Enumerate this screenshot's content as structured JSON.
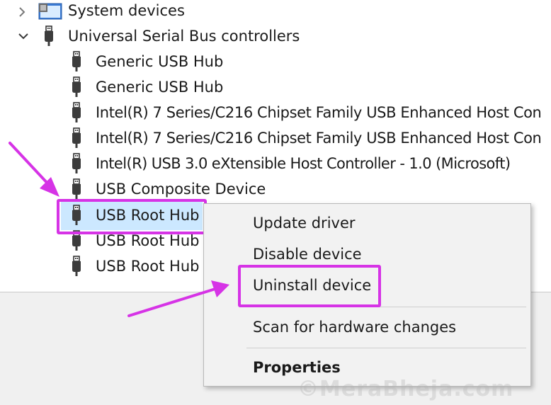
{
  "tree": {
    "system_devices": {
      "label": "System devices",
      "expanded": false,
      "icon": "system-devices-icon"
    },
    "usb_controllers": {
      "label": "Universal Serial Bus controllers",
      "expanded": true,
      "icon": "usb-plug-icon"
    },
    "children": [
      {
        "label": "Generic USB Hub",
        "icon": "usb-plug-icon",
        "selected": false
      },
      {
        "label": "Generic USB Hub",
        "icon": "usb-plug-icon",
        "selected": false
      },
      {
        "label": "Intel(R) 7 Series/C216 Chipset Family USB Enhanced Host Con",
        "icon": "usb-plug-icon",
        "selected": false
      },
      {
        "label": "Intel(R) 7 Series/C216 Chipset Family USB Enhanced Host Con",
        "icon": "usb-plug-icon",
        "selected": false
      },
      {
        "label": "Intel(R) USB 3.0 eXtensible Host Controller - 1.0 (Microsoft)",
        "icon": "usb-plug-icon",
        "selected": false
      },
      {
        "label": "USB Composite Device",
        "icon": "usb-plug-icon",
        "selected": false
      },
      {
        "label": "USB Root Hub",
        "icon": "usb-plug-icon",
        "selected": true
      },
      {
        "label": "USB Root Hub",
        "icon": "usb-plug-icon",
        "selected": false
      },
      {
        "label": "USB Root Hub",
        "icon": "usb-plug-icon",
        "selected": false
      }
    ]
  },
  "context_menu": {
    "items": [
      {
        "label": "Update driver",
        "bold": false
      },
      {
        "label": "Disable device",
        "bold": false
      },
      {
        "label": "Uninstall device",
        "bold": false,
        "highlighted": true
      },
      {
        "label": "Scan for hardware changes",
        "bold": false
      },
      {
        "label": "Properties",
        "bold": true
      }
    ]
  },
  "annotation_color": "#d633e6",
  "selection_color": "#cce8ff",
  "watermark": "©MeraBheja.com"
}
